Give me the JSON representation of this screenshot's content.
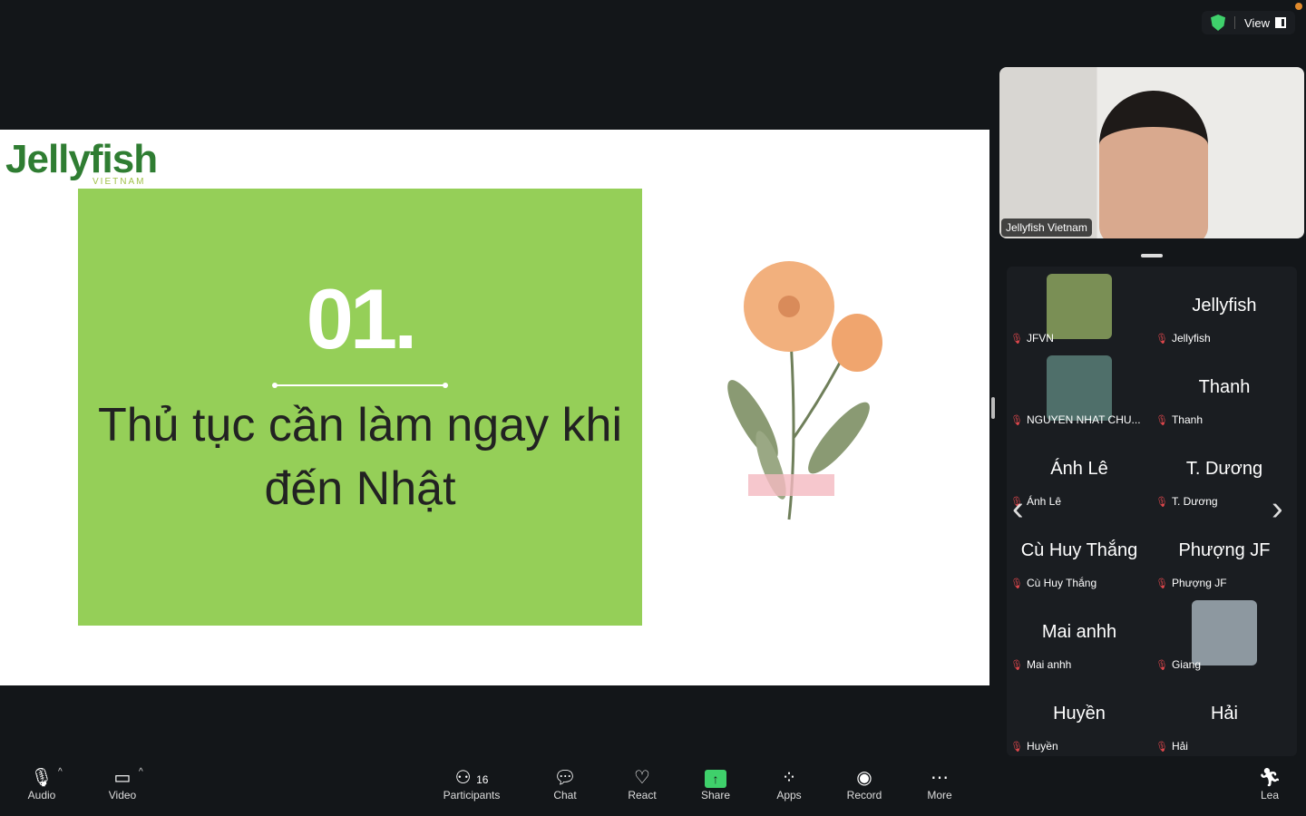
{
  "topbar": {
    "view_label": "View",
    "security": "shield-check-icon"
  },
  "slide": {
    "logo": "Jellyfish",
    "logo_sub": "VIETNAM",
    "number": "01.",
    "title": "Thủ tục cần làm ngay khi đến Nhật",
    "accent": "#95cf58"
  },
  "self_view": {
    "name": "Jellyfish Vietnam"
  },
  "participants": [
    {
      "big": "",
      "label": "JFVN",
      "thumb": "#7a8f55"
    },
    {
      "big": "Jellyfish",
      "label": "Jellyfish"
    },
    {
      "big": "",
      "label": "NGUYEN NHAT CHU...",
      "thumb": "#4f6f6a"
    },
    {
      "big": "Thanh",
      "label": "Thanh"
    },
    {
      "big": "Ánh Lê",
      "label": "Ánh Lê"
    },
    {
      "big": "T. Dương",
      "label": "T. Dương"
    },
    {
      "big": "Cù Huy Thắng",
      "label": "Cù Huy Thắng"
    },
    {
      "big": "Phượng JF",
      "label": "Phượng JF"
    },
    {
      "big": "Mai anhh",
      "label": "Mai anhh"
    },
    {
      "big": "",
      "label": "Giang",
      "thumb": "#8d98a0"
    },
    {
      "big": "Huyền",
      "label": "Huyền"
    },
    {
      "big": "Hải",
      "label": "Hải"
    }
  ],
  "toolbar": {
    "audio": "Audio",
    "video": "Video",
    "participants": "Participants",
    "participants_count": "16",
    "chat": "Chat",
    "react": "React",
    "share": "Share",
    "apps": "Apps",
    "record": "Record",
    "more": "More",
    "leave": "Lea"
  }
}
